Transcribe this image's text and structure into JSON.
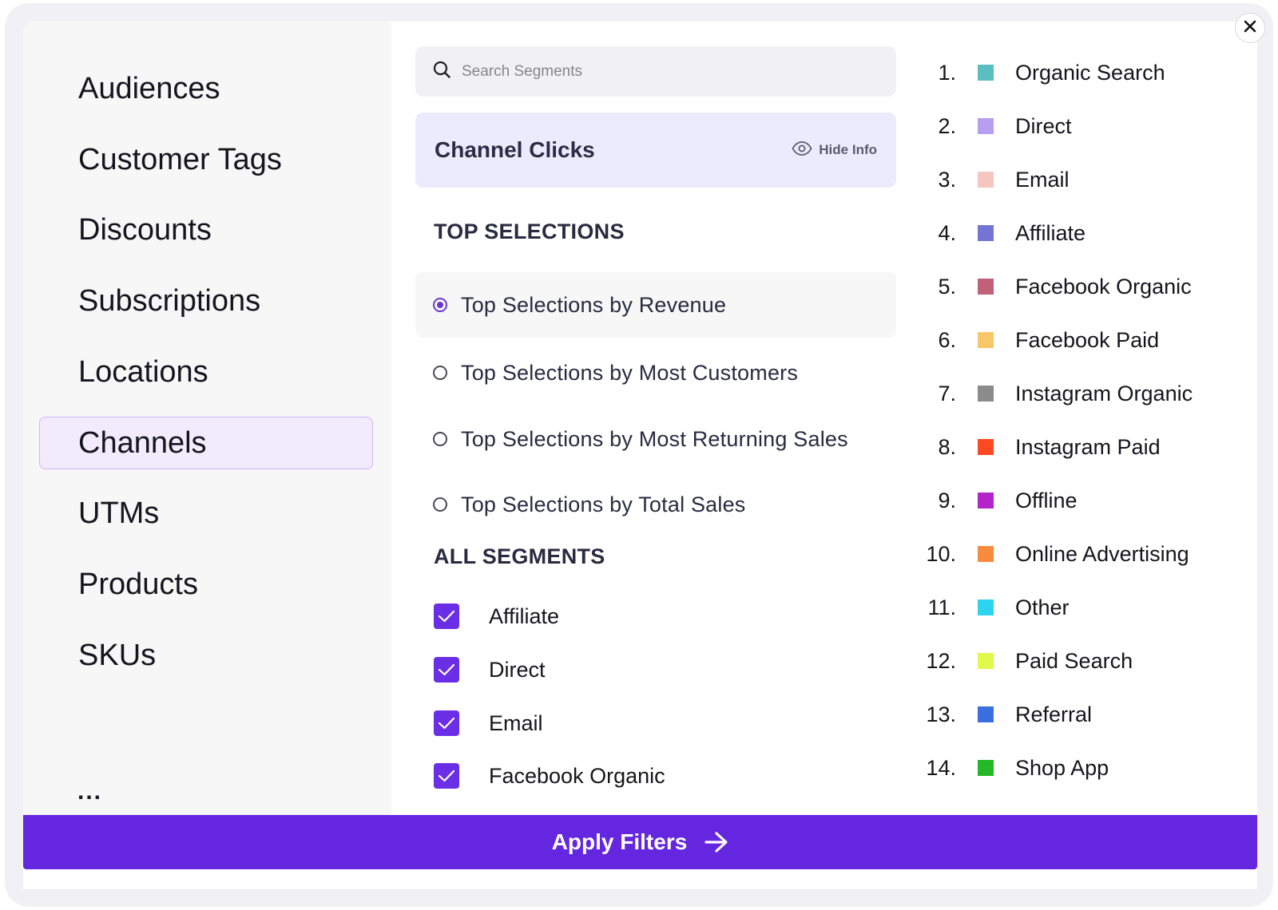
{
  "close": {
    "icon": "close-icon"
  },
  "sidebar": {
    "items": [
      {
        "label": "Audiences",
        "active": false
      },
      {
        "label": "Customer Tags",
        "active": false
      },
      {
        "label": "Discounts",
        "active": false
      },
      {
        "label": "Subscriptions",
        "active": false
      },
      {
        "label": "Locations",
        "active": false
      },
      {
        "label": "Channels",
        "active": true
      },
      {
        "label": "UTMs",
        "active": false
      },
      {
        "label": "Products",
        "active": false
      },
      {
        "label": "SKUs",
        "active": false
      }
    ],
    "more": "..."
  },
  "search": {
    "placeholder": "Search Segments",
    "value": "",
    "icon": "search-icon"
  },
  "info_card": {
    "title": "Channel Clicks",
    "hide_label": "Hide Info",
    "icon": "eye-icon"
  },
  "top_selections": {
    "heading": "TOP SELECTIONS",
    "options": [
      {
        "label": "Top Selections by Revenue",
        "selected": true
      },
      {
        "label": "Top Selections by Most Customers",
        "selected": false
      },
      {
        "label": "Top Selections by Most Returning Sales",
        "selected": false
      },
      {
        "label": "Top Selections by Total Sales",
        "selected": false
      }
    ]
  },
  "all_segments": {
    "heading": "ALL SEGMENTS",
    "items": [
      {
        "label": "Affiliate",
        "checked": true
      },
      {
        "label": "Direct",
        "checked": true
      },
      {
        "label": "Email",
        "checked": true
      },
      {
        "label": "Facebook Organic",
        "checked": true
      }
    ]
  },
  "legend": [
    {
      "num": "1.",
      "label": "Organic Search",
      "color": "#5bbfbf"
    },
    {
      "num": "2.",
      "label": "Direct",
      "color": "#b89ef0"
    },
    {
      "num": "3.",
      "label": "Email",
      "color": "#f7c5c0"
    },
    {
      "num": "4.",
      "label": "Affiliate",
      "color": "#7474d4"
    },
    {
      "num": "5.",
      "label": "Facebook Organic",
      "color": "#c0607a"
    },
    {
      "num": "6.",
      "label": "Facebook Paid",
      "color": "#f8c868"
    },
    {
      "num": "7.",
      "label": "Instagram Organic",
      "color": "#8b8b8b"
    },
    {
      "num": "8.",
      "label": "Instagram Paid",
      "color": "#fb4a22"
    },
    {
      "num": "9.",
      "label": "Offline",
      "color": "#b424c8"
    },
    {
      "num": "10.",
      "label": "Online Advertising",
      "color": "#f78d3c"
    },
    {
      "num": "11.",
      "label": "Other",
      "color": "#2ed3f0"
    },
    {
      "num": "12.",
      "label": "Paid Search",
      "color": "#dffa4a"
    },
    {
      "num": "13.",
      "label": "Referral",
      "color": "#3a6fe0"
    },
    {
      "num": "14.",
      "label": "Shop App",
      "color": "#22b826"
    }
  ],
  "apply": {
    "label": "Apply Filters",
    "icon": "arrow-right-icon"
  },
  "colors": {
    "accent": "#6526e0",
    "active_bg": "#f1ecfd",
    "card_bg": "#ebebfd"
  }
}
